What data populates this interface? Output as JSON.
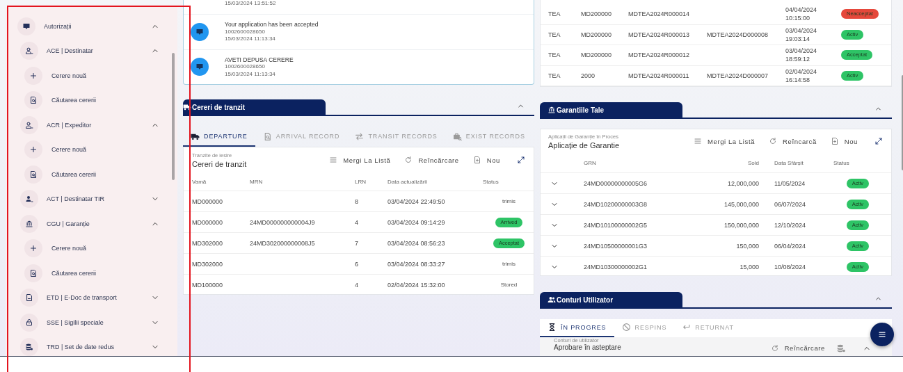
{
  "sidebar": {
    "items": [
      {
        "label": "Autorizații",
        "kind": "monitor",
        "expanded": true,
        "children": [
          {
            "label": "ACE | Destinatar",
            "kind": "person",
            "expanded": true,
            "children": [
              {
                "label": "Cerere nouă",
                "kind": "plus"
              },
              {
                "label": "Căutarea cererii",
                "kind": "doc-search"
              }
            ]
          },
          {
            "label": "ACR | Expeditor",
            "kind": "person",
            "expanded": true,
            "children": [
              {
                "label": "Cerere nouă",
                "kind": "plus"
              },
              {
                "label": "Căutarea cererii",
                "kind": "doc-search"
              }
            ]
          },
          {
            "label": "ACT | Destinatar TIR",
            "kind": "person-filled",
            "expanded": false
          },
          {
            "label": "CGU | Garanție",
            "kind": "bank",
            "expanded": true,
            "children": [
              {
                "label": "Cerere nouă",
                "kind": "plus"
              },
              {
                "label": "Căutarea cererii",
                "kind": "doc-search"
              }
            ]
          },
          {
            "label": "ETD | E-Doc de transport",
            "kind": "doc",
            "expanded": false
          },
          {
            "label": "SSE | Sigilii speciale",
            "kind": "lock",
            "expanded": false
          },
          {
            "label": "TRD | Set de date redus",
            "kind": "database",
            "expanded": false
          }
        ]
      }
    ]
  },
  "notifications": [
    {
      "time": "15/03/2024 13:51:52"
    },
    {
      "title": "Your application has been accepted",
      "number": "1002600028650",
      "time": "15/03/2024 11:13:34"
    },
    {
      "title": "AVETI DEPUSA CERERE",
      "number": "1002600028650",
      "time": "15/03/2024 11:13:34"
    }
  ],
  "transit": {
    "title": "Cereri de tranzit",
    "expanded": true,
    "tabs": [
      {
        "label": "DEPARTURE",
        "kind": "truck",
        "selected": true
      },
      {
        "label": "ARRIVAL RECORD",
        "kind": "doc-search",
        "selected": false
      },
      {
        "label": "TRANSIT RECORDS",
        "kind": "transit",
        "selected": false
      },
      {
        "label": "EXIST RECORDS",
        "kind": "briefcase",
        "selected": false
      }
    ],
    "subtitle": "Tranzite de ieșire",
    "heading": "Cereri de tranzit",
    "actions": [
      {
        "label": "Mergi La Listă",
        "kind": "list"
      },
      {
        "label": "Reîncărcare",
        "kind": "reload"
      },
      {
        "label": "Nou",
        "kind": "new"
      }
    ],
    "columns": [
      "Vamă",
      "MRN",
      "LRN",
      "Data actualizării",
      "Status"
    ],
    "rows": [
      {
        "vama": "MD000000",
        "lrn": "8",
        "date": "03/04/2024 22:49:50",
        "status": {
          "label": "trimis",
          "kind": "text"
        }
      },
      {
        "vama": "MD000000",
        "mrn": "24MD000000000004J9",
        "lrn": "4",
        "date": "03/04/2024 09:14:29",
        "status": {
          "label": "Arrived",
          "kind": "badge",
          "color": "#2ec466"
        }
      },
      {
        "vama": "MD302000",
        "mrn": "24MD302000000008J5",
        "lrn": "7",
        "date": "03/04/2024 08:56:23",
        "status": {
          "label": "Acceptat",
          "kind": "badge",
          "color": "#2ec466"
        }
      },
      {
        "vama": "MD302000",
        "lrn": "6",
        "date": "03/04/2024 08:33:27",
        "status": {
          "label": "trimis",
          "kind": "text"
        }
      },
      {
        "vama": "MD100000",
        "lrn": "4",
        "date": "02/04/2024 15:32:00",
        "status": {
          "label": "Stored",
          "kind": "text"
        }
      }
    ]
  },
  "records": {
    "rows": [
      {
        "column_1": "TEA",
        "column_2": "MD200000",
        "column_3": "MDTEA2024R000014",
        "column_5": "04/04/2024 10:15:00",
        "status": {
          "label": "Neacceptat",
          "kind": "badge",
          "color": "#e5483b"
        }
      },
      {
        "column_1": "TEA",
        "column_2": "MD200000",
        "column_3": "MDTEA2024R000013",
        "column_4": "MDTEA2024D000008",
        "column_5": "03/04/2024 19:03:14",
        "status": {
          "label": "Activ",
          "kind": "badge",
          "color": "#2ec466"
        }
      },
      {
        "column_1": "TEA",
        "column_2": "MD200000",
        "column_3": "MDTEA2024R000012",
        "column_5": "03/04/2024 18:59:12",
        "status": {
          "label": "Acceptat",
          "kind": "badge",
          "color": "#2ec466"
        }
      },
      {
        "column_1": "TEA",
        "column_2": "2000",
        "column_3": "MDTEA2024R000011",
        "column_4": "MDTEA2024D000007",
        "column_5": "02/04/2024 16:14:58",
        "status": {
          "label": "Activ",
          "kind": "badge",
          "color": "#2ec466"
        }
      }
    ]
  },
  "guarantees": {
    "title": "Garantiile Tale",
    "expanded": true,
    "subtitle": "Aplicații de Garanție în Proces",
    "heading": "Aplicație de Garantie",
    "actions": [
      {
        "label": "Mergi La Listă",
        "kind": "list"
      },
      {
        "label": "Reîncarcă",
        "kind": "reload"
      },
      {
        "label": "Nou",
        "kind": "new"
      }
    ],
    "columns": [
      "GRN",
      "Sold",
      "Data Sfârșit",
      "Status"
    ],
    "rows": [
      {
        "grn": "24MD00000000005G6",
        "sold": "12,000,000",
        "end_date": "11/05/2024",
        "expanded": false,
        "status": {
          "label": "Activ",
          "kind": "badge",
          "color": "#2ec466"
        }
      },
      {
        "grn": "24MD10200000003G8",
        "sold": "145,000,000",
        "end_date": "06/07/2024",
        "expanded": false,
        "status": {
          "label": "Activ",
          "kind": "badge",
          "color": "#2ec466"
        }
      },
      {
        "grn": "24MD10100000002G5",
        "sold": "150,000,000",
        "end_date": "12/10/2024",
        "expanded": false,
        "status": {
          "label": "Activ",
          "kind": "badge",
          "color": "#2ec466"
        }
      },
      {
        "grn": "24MD10500000001G3",
        "sold": "150,000",
        "end_date": "06/04/2024",
        "expanded": false,
        "status": {
          "label": "Activ",
          "kind": "badge",
          "color": "#2ec466"
        }
      },
      {
        "grn": "24MD10300000002G1",
        "sold": "15,000",
        "end_date": "10/08/2024",
        "expanded": false,
        "status": {
          "label": "Activ",
          "kind": "badge",
          "color": "#2ec466"
        }
      }
    ]
  },
  "accounts": {
    "title": "Conturi Utilizator",
    "expanded": true,
    "tabs": [
      {
        "label": "ÎN PROGRES",
        "kind": "hourglass",
        "selected": true
      },
      {
        "label": "RESPINS",
        "kind": "blocked",
        "selected": false
      },
      {
        "label": "RETURNAT",
        "kind": "return",
        "selected": false
      }
    ],
    "subtitle": "Conturi de utilizator",
    "heading": "Aprobare în asteptare",
    "actions": [
      {
        "label": "Reîncărcare",
        "kind": "reload"
      },
      {
        "kind": "database"
      }
    ],
    "list_expanded": true
  }
}
